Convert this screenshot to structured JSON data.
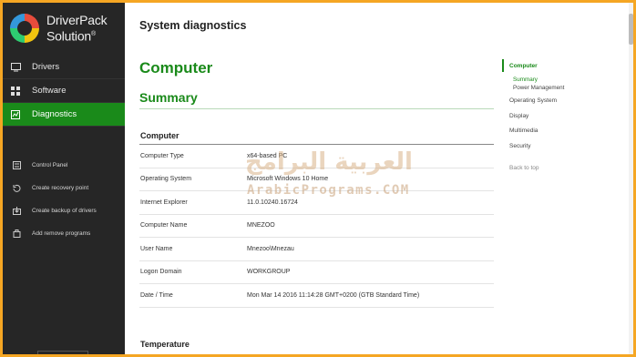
{
  "app": {
    "logo_line1": "DriverPack",
    "logo_line2": "Solution",
    "logo_mark": "®"
  },
  "sidebar": {
    "nav": [
      {
        "label": "Drivers",
        "icon": "monitor-icon"
      },
      {
        "label": "Software",
        "icon": "grid-icon"
      },
      {
        "label": "Diagnostics",
        "icon": "chart-icon",
        "active": true
      }
    ],
    "tools": [
      {
        "label": "Control Panel",
        "icon": "control-panel-icon"
      },
      {
        "label": "Create recovery point",
        "icon": "recovery-icon"
      },
      {
        "label": "Create backup of drivers",
        "icon": "backup-icon"
      },
      {
        "label": "Add remove programs",
        "icon": "box-icon"
      }
    ]
  },
  "main": {
    "page_title": "System diagnostics",
    "heading": "Computer",
    "subheading": "Summary",
    "section1": "Computer",
    "rows": [
      {
        "key": "Computer Type",
        "value": "x64-based PC"
      },
      {
        "key": "Operating System",
        "value": "Microsoft Windows 10 Home"
      },
      {
        "key": "Internet Explorer",
        "value": "11.0.10240.16724"
      },
      {
        "key": "Computer Name",
        "value": "MNEZOO"
      },
      {
        "key": "User Name",
        "value": "Mnezoo\\Mnezau"
      },
      {
        "key": "Logon Domain",
        "value": "WORKGROUP"
      },
      {
        "key": "Date / Time",
        "value": "Mon Mar 14 2016 11:14:28 GMT+0200 (GTB Standard Time)"
      }
    ],
    "section2": "Temperature"
  },
  "right_nav": {
    "items": [
      {
        "label": "Computer"
      },
      {
        "label": "Summary"
      },
      {
        "label": "Power Management"
      },
      {
        "label": "Operating System"
      },
      {
        "label": "Display"
      },
      {
        "label": "Multimedia"
      },
      {
        "label": "Security"
      },
      {
        "label": "Back to top"
      }
    ]
  },
  "watermark": {
    "arabic": "العربية البرامج",
    "latin": "ArabicPrograms.COM"
  },
  "colors": {
    "accent": "#1a8a1a",
    "sidebar_bg": "#262626",
    "frame": "#f5a623"
  }
}
